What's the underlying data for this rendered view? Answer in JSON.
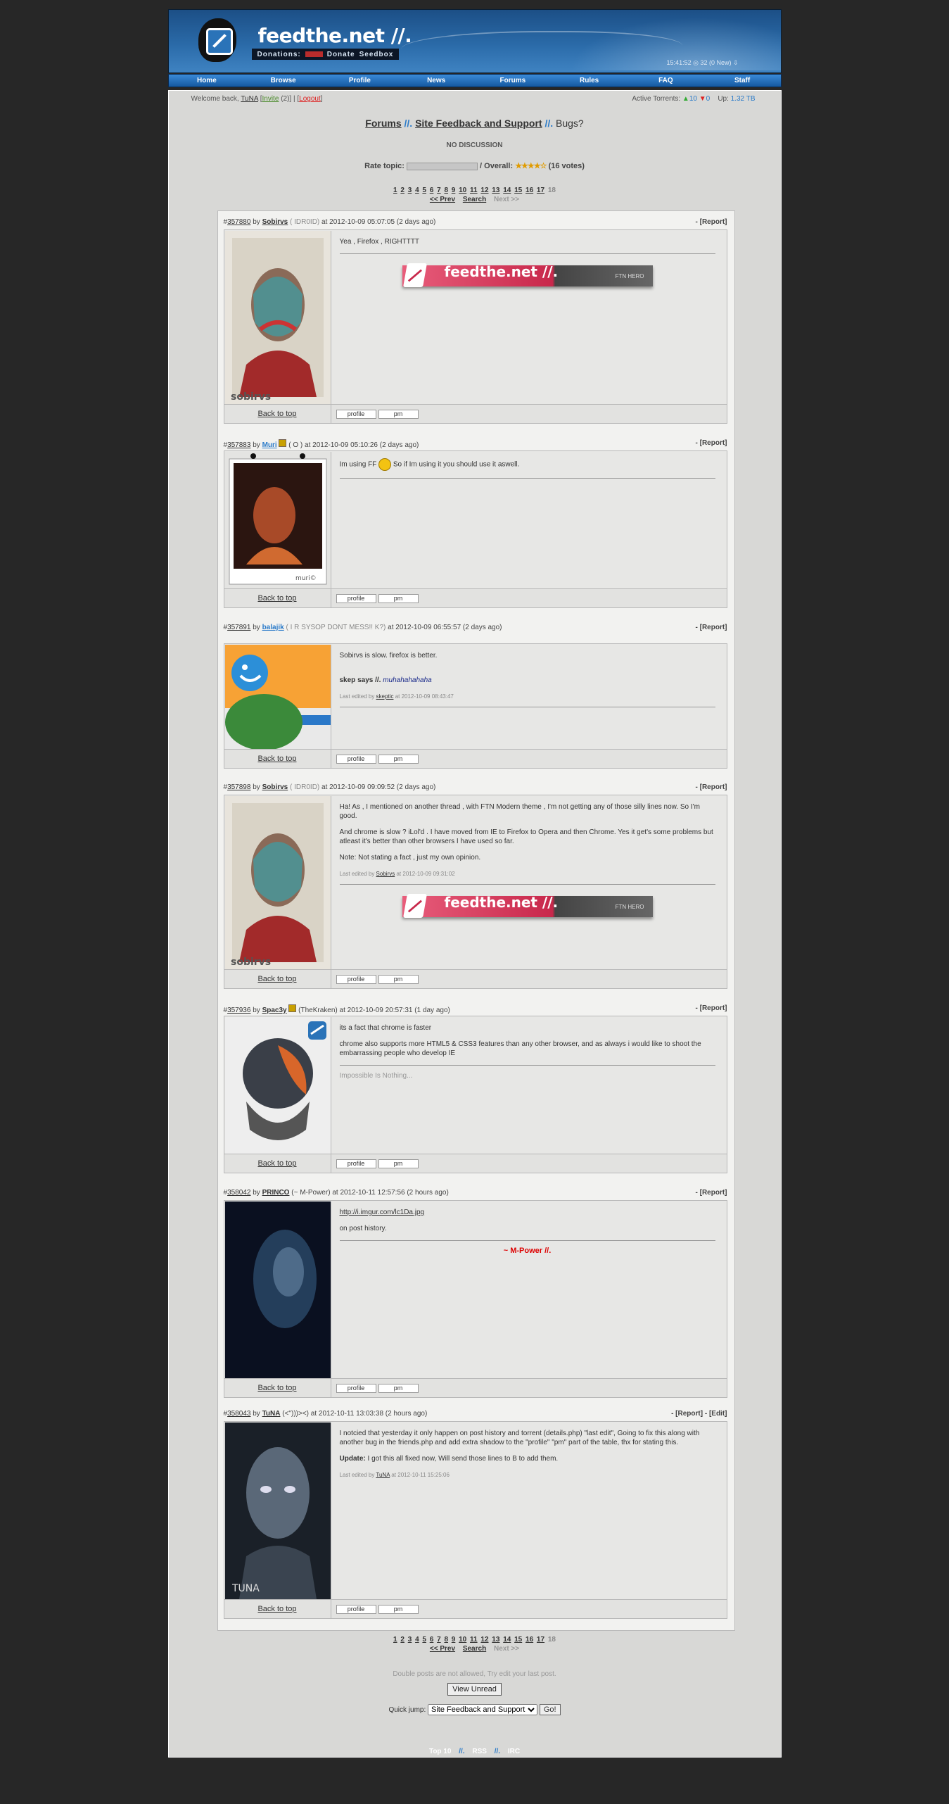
{
  "header": {
    "site_name": "feedthe.net //.",
    "donations_label": "Donations:",
    "donate_label": "Donate",
    "seedbox_label": "Seedbox",
    "clock": "15:41:52 ◎ 32 (0 New) ⇩"
  },
  "nav": [
    "Home",
    "Browse",
    "Profile",
    "News",
    "Forums",
    "Rules",
    "FAQ",
    "Staff"
  ],
  "welcome": {
    "prefix": "Welcome back,",
    "user": "TuNA",
    "invite": "Invite",
    "invite_count": "(2)",
    "logout": "Logout"
  },
  "active": {
    "label": "Active Torrents:",
    "seeding": "10",
    "leeching": "0",
    "up_label": "Up:",
    "up_value": "1.32 TB"
  },
  "breadcrumb": {
    "forums": "Forums",
    "sep": "//.",
    "section": "Site Feedback and Support",
    "topic": "Bugs?"
  },
  "no_discussion": "NO DISCUSSION",
  "rating": {
    "label": "Rate topic:",
    "overall_label": "/ Overall:",
    "stars": "★★★★☆",
    "votes": "(16 votes)"
  },
  "pagination": {
    "pages": [
      "1",
      "2",
      "3",
      "4",
      "5",
      "6",
      "7",
      "8",
      "9",
      "10",
      "11",
      "12",
      "13",
      "14",
      "15",
      "16",
      "17"
    ],
    "current": "18",
    "prev": "<< Prev",
    "search": "Search",
    "next": "Next >>"
  },
  "posts": [
    {
      "id": "357880",
      "user": "Sobirvs",
      "note": "( IDR0ID)",
      "date": "at 2012-10-09 05:07:05 (2 days ago)",
      "actions": "- [Report]",
      "lines": [
        "Yea , Firefox , RIGHTTTT"
      ]
    },
    {
      "id": "357883",
      "user": "Muri",
      "note": "( O )",
      "date": "at 2012-10-09 05:10:26 (2 days ago)",
      "actions": "- [Report]",
      "lines": [
        "Im using FF",
        "So if Im using it you should use it aswell."
      ]
    },
    {
      "id": "357891",
      "user": "balajik",
      "note": "( I R SYSOP DONT MESS!! K?)",
      "date": "at 2012-10-09 06:55:57 (2 days ago)",
      "actions": "- [Report]",
      "lines": [
        "Sobirvs is slow. firefox is better.",
        "skep says //.",
        "muhahahahaha",
        "Last edited by",
        "skeptic",
        "at 2012-10-09 08:43:47"
      ]
    },
    {
      "id": "357898",
      "user": "Sobirvs",
      "note": "( IDR0ID)",
      "date": "at 2012-10-09 09:09:52 (2 days ago)",
      "actions": "- [Report]",
      "lines": [
        "Ha! As , I mentioned on another thread , with FTN Modern theme , I'm not getting any of those silly lines now. So I'm good.",
        "And chrome is slow ? iLol'd . I have moved from IE to Firefox to Opera and then Chrome. Yes it get's some problems but atleast it's better than other browsers I have used so far.",
        "Note: Not stating a fact , just my own opinion.",
        "Last edited by",
        "Sobirvs",
        "at 2012-10-09 09:31:02"
      ]
    },
    {
      "id": "357936",
      "user": "Spac3y",
      "note": "(TheKraken)",
      "date": "at 2012-10-09 20:57:31 (1 day ago)",
      "actions": "- [Report]",
      "lines": [
        "its a fact that chrome is faster",
        "chrome also supports more HTML5 & CSS3 features than any other browser, and as always i would like to shoot the embarrassing people who develop IE",
        "Impossible Is Nothing..."
      ]
    },
    {
      "id": "358042",
      "user": "PRINCO",
      "note": "(~ M-Power)",
      "date": "at 2012-10-11 12:57:56 (2 hours ago)",
      "actions": "- [Report]",
      "lines": [
        "http://i.imgur.com/lc1Da.jpg",
        "on post history.",
        "~ M-Power",
        "//."
      ]
    },
    {
      "id": "358043",
      "user": "TuNA",
      "note": "(<\")))><)",
      "date": "at 2012-10-11 13:03:38 (2 hours ago)",
      "actions": "- [Report] - [Edit]",
      "lines": [
        "I notcied that yesterday it only happen on post history and torrent (details.php) \"last edit\", Going to fix this along with another bug in the friends.php and add extra shadow to the \"profile\" \"pm\" part of the table, thx for stating this.",
        "Update:",
        "I got this all fixed now, Will send those lines to B to add them.",
        "Last edited by",
        "TuNA",
        "at 2012-10-11 15:25:06"
      ]
    }
  ],
  "post_footer": {
    "back_to_top": "Back to top",
    "profile": "profile",
    "pm": "pm"
  },
  "banner": {
    "text": "feedthe.net //.",
    "tag": "FTN HERO"
  },
  "avatar_labels": {
    "sobirvs": "sobirvs",
    "muri": "muri©",
    "tuna": "TUNA"
  },
  "double_post_notice": "Double posts are not allowed, Try edit your last post.",
  "view_unread": "View Unread",
  "quick_jump": {
    "label": "Quick jump:",
    "selected": "Site Feedback and Support",
    "go": "Go!"
  },
  "bottom_links": {
    "top10": "Top 10",
    "sep": "//.",
    "rss": "RSS",
    "irc": "IRC"
  }
}
